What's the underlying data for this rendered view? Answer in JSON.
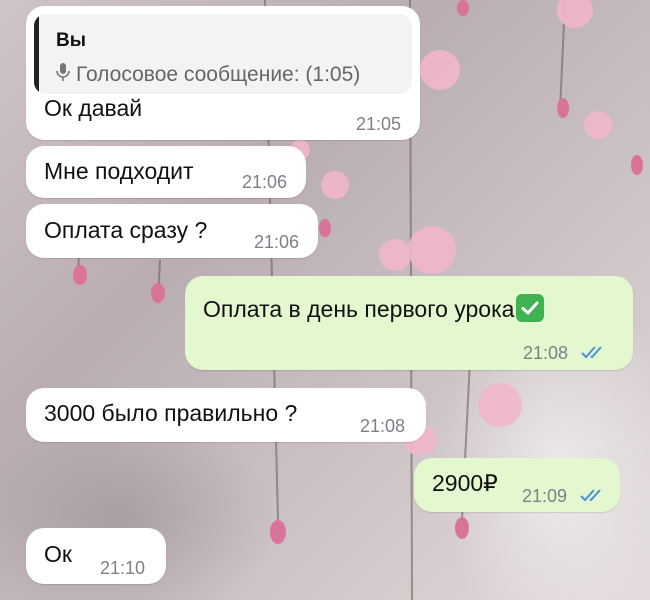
{
  "chat": {
    "messages": [
      {
        "direction": "incoming",
        "reply": {
          "sender": "Вы",
          "preview": "Голосовое сообщение: (1:05)",
          "icon": "microphone-icon"
        },
        "text": "Ок давай",
        "time": "21:05"
      },
      {
        "direction": "incoming",
        "text": "Мне подходит",
        "time": "21:06"
      },
      {
        "direction": "incoming",
        "text": "Оплата сразу ?",
        "time": "21:06"
      },
      {
        "direction": "outgoing",
        "text": "Оплата в день первого урока",
        "emoji": "check-mark-button-icon",
        "time": "21:08",
        "status": "read"
      },
      {
        "direction": "incoming",
        "text": "3000 было правильно ?",
        "time": "21:08"
      },
      {
        "direction": "outgoing",
        "text": "2900₽",
        "time": "21:09",
        "status": "read"
      },
      {
        "direction": "incoming",
        "text": "Ок",
        "time": "21:10"
      }
    ]
  },
  "colors": {
    "incoming_bubble": "#ffffff",
    "outgoing_bubble": "#e4f8cf",
    "read_ticks": "#4a90d9",
    "check_emoji": "#3fb34f"
  }
}
